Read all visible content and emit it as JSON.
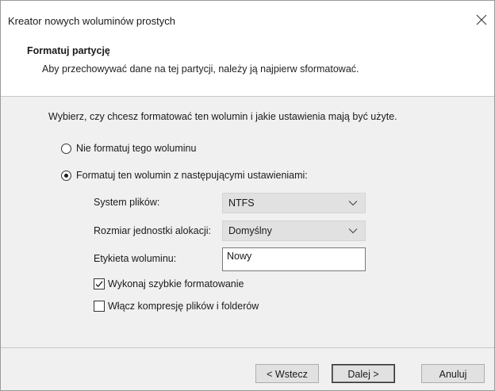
{
  "window": {
    "title": "Kreator nowych woluminów prostych"
  },
  "header": {
    "title": "Formatuj partycję",
    "subtitle": "Aby przechowywać dane na tej partycji, należy ją najpierw sformatować."
  },
  "content": {
    "instruction": "Wybierz, czy chcesz formatować ten wolumin i jakie ustawienia mają być użyte.",
    "radio_no_format": {
      "label": "Nie formatuj tego woluminu",
      "checked": false
    },
    "radio_format": {
      "label": "Formatuj ten wolumin z następującymi ustawieniami:",
      "checked": true
    },
    "filesystem": {
      "label": "System plików:",
      "value": "NTFS"
    },
    "allocation": {
      "label": "Rozmiar jednostki alokacji:",
      "value": "Domyślny"
    },
    "volume_label": {
      "label": "Etykieta woluminu:",
      "value": "Nowy"
    },
    "quick_format": {
      "label": "Wykonaj szybkie formatowanie",
      "checked": true
    },
    "compression": {
      "label": "Włącz kompresję plików i folderów",
      "checked": false
    }
  },
  "footer": {
    "back_label": "< Wstecz",
    "next_label": "Dalej >",
    "cancel_label": "Anuluj"
  },
  "icons": {
    "close": "close-icon",
    "chevron": "chevron-down-icon",
    "check": "checkmark-icon"
  }
}
